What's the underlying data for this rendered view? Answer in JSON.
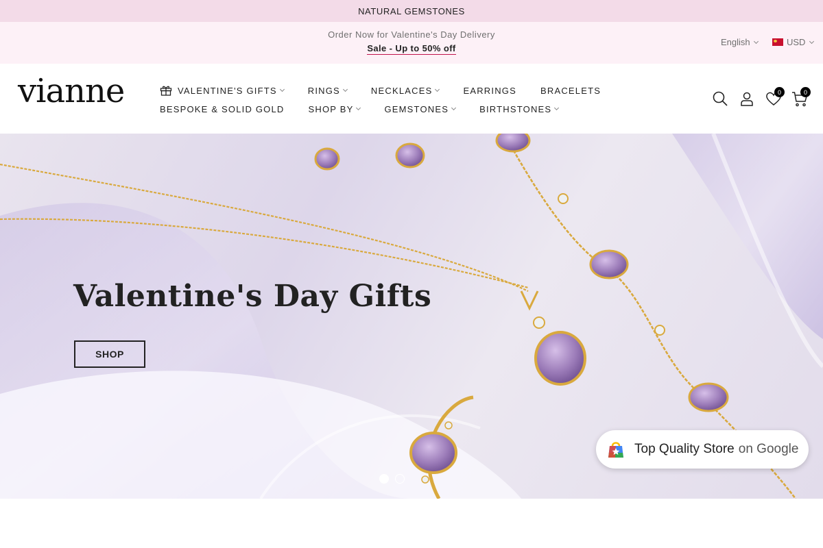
{
  "announcement": {
    "text": "NATURAL GEMSTONES"
  },
  "promo": {
    "line1": "Order Now for Valentine's Day Delivery",
    "line2": "Sale - Up to 50% off"
  },
  "locale": {
    "language": "English",
    "currency": "USD"
  },
  "header": {
    "logo": "vianne",
    "nav_row1": [
      "VALENTINE'S GIFTS",
      "RINGS",
      "NECKLACES",
      "EARRINGS",
      "BRACELETS"
    ],
    "nav_row2": [
      "BESPOKE & SOLID GOLD",
      "SHOP BY",
      "GEMSTONES",
      "BIRTHSTONES"
    ],
    "wishlist_count": "0",
    "cart_count": "0"
  },
  "hero": {
    "title": "Valentine's Day Gifts",
    "button": "SHOP",
    "slides": 3,
    "active_slide": 1
  },
  "google_badge": {
    "main": "Top Quality Store",
    "suffix": "on Google"
  },
  "colors": {
    "topbar": "#f3dbe8",
    "promobar": "#fdf1f7",
    "accent_underline": "#c0134c",
    "gold": "#d9a93e",
    "amethyst": "#9b7bb8"
  },
  "icons": [
    "gift-icon",
    "search-icon",
    "account-icon",
    "heart-icon",
    "cart-icon",
    "flag-icon"
  ]
}
